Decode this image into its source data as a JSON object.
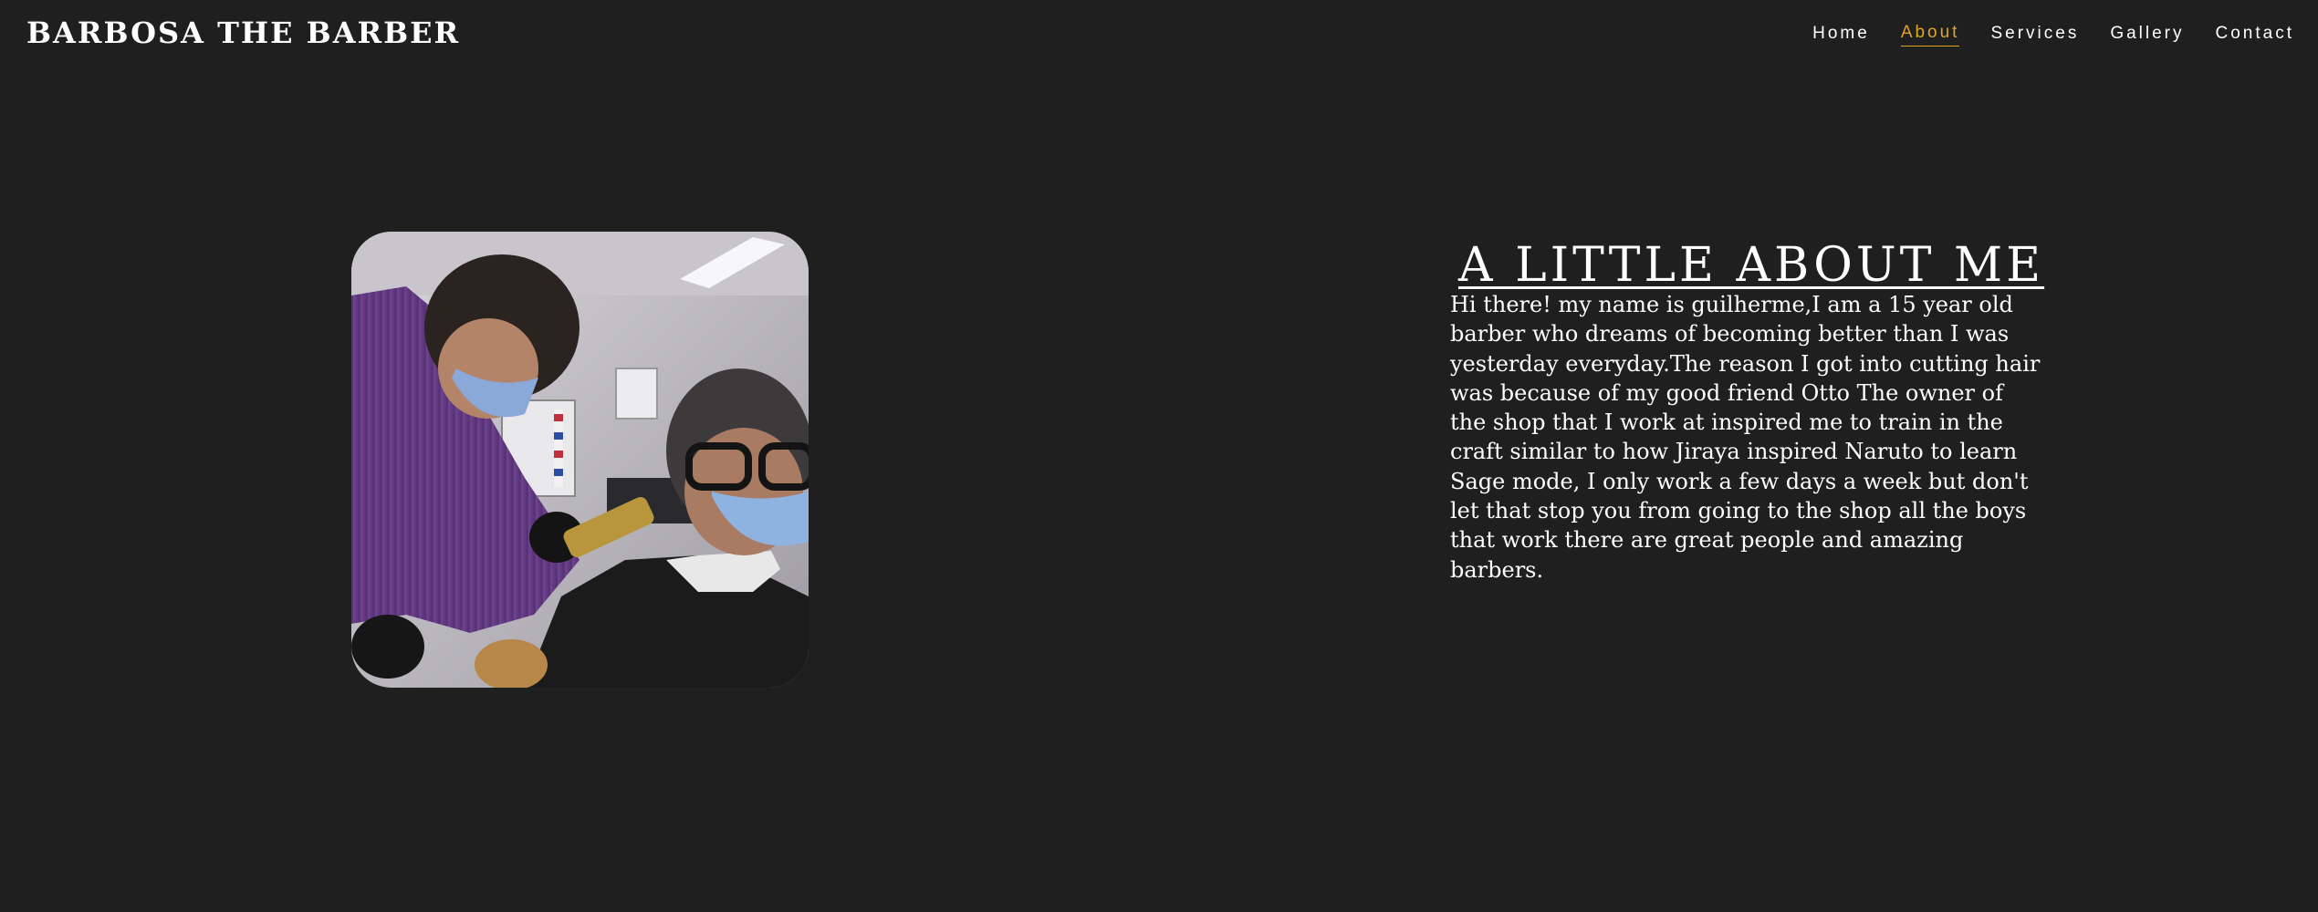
{
  "header": {
    "brand": "BARBOSA THE BARBER",
    "nav": {
      "home": "Home",
      "about": "About",
      "services": "Services",
      "gallery": "Gallery",
      "contact": "Contact"
    },
    "active_color": "#e0a526"
  },
  "about": {
    "title": "A LITTLE ABOUT ME",
    "body": "Hi there! my name is guilherme,I am a 15 year old barber who dreams of becoming better than I was yesterday everyday.The reason I got into cutting hair was because of my good friend Otto The owner of the shop that I work at inspired me to train in the craft similar to how Jiraya inspired Naruto to learn Sage mode, I only work a few days a week but don't let that stop you from going to the shop all the boys that work there are great people and amazing barbers."
  },
  "colors": {
    "background": "#1f1f1f",
    "text": "#ffffff",
    "accent": "#e0a526"
  }
}
